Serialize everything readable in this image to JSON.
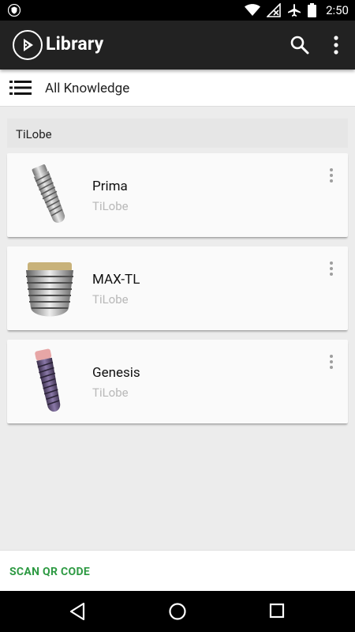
{
  "status_bar": {
    "time": "2:50",
    "left_icon": "shield-icon",
    "right_icons": [
      "wifi-icon",
      "signal-off-icon",
      "airplane-icon",
      "battery-icon"
    ]
  },
  "app_bar": {
    "title": "Library",
    "logo_icon": "play-logo-icon",
    "actions": [
      "search-icon",
      "more-vert-icon"
    ]
  },
  "sub_header": {
    "title": "All Knowledge",
    "icon": "list-icon"
  },
  "section": {
    "label": "TiLobe"
  },
  "items": [
    {
      "title": "Prima",
      "subtitle": "TiLobe",
      "thumb": "implant-thin-silver"
    },
    {
      "title": "MAX-TL",
      "subtitle": "TiLobe",
      "thumb": "implant-wide-silver"
    },
    {
      "title": "Genesis",
      "subtitle": "TiLobe",
      "thumb": "implant-purple"
    }
  ],
  "bottom_action": {
    "label": "SCAN QR CODE"
  },
  "colors": {
    "app_bar": "#222222",
    "accent_green": "#2e9a43",
    "background": "#ececec"
  }
}
